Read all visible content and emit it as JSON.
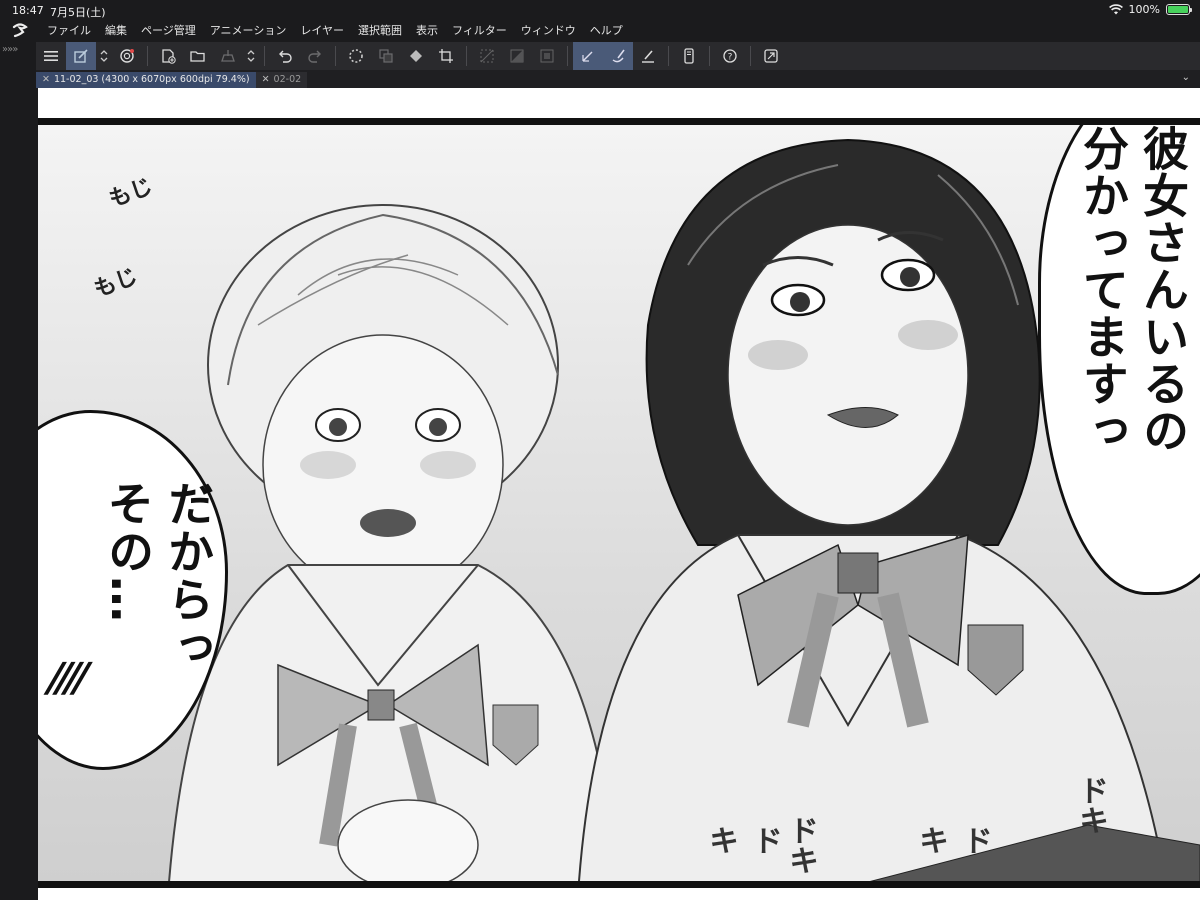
{
  "status": {
    "time": "18:47",
    "date": "7月5日(土)",
    "battery": "100%",
    "battery_level": 1.0,
    "battery_color": "#47d15c"
  },
  "menu": {
    "items": [
      "ファイル",
      "編集",
      "ページ管理",
      "アニメーション",
      "レイヤー",
      "選択範囲",
      "表示",
      "フィルター",
      "ウィンドウ",
      "ヘルプ"
    ]
  },
  "toolbar": {
    "icons": [
      "menu-icon",
      "canvas-icon",
      "stepper-icon",
      "clip-icon",
      "new-page-icon",
      "open-icon",
      "save-icon",
      "stepper-icon",
      "undo-icon",
      "redo-icon",
      "loading-icon",
      "copy-icon",
      "fill-icon",
      "crop-icon",
      "deselect-icon",
      "gradient-icon",
      "frame-icon",
      "ruler-pen-icon",
      "brush-icon",
      "ink-icon",
      "device-icon",
      "help-icon",
      "expand-icon"
    ],
    "accent_color": "#4a5a78"
  },
  "tabs": [
    {
      "label": "11-02_03 (4300 x 6070px 600dpi 79.4%)",
      "active": true
    },
    {
      "label": "02-02",
      "active": false
    }
  ],
  "canvas": {
    "speech_left": "だからっ\nその…",
    "speech_left_marks": "////",
    "speech_right": "彼女さんいるの\n分かってますっ",
    "sfx_mozi": "もじ",
    "sfx_vibrate": "ドキ"
  }
}
